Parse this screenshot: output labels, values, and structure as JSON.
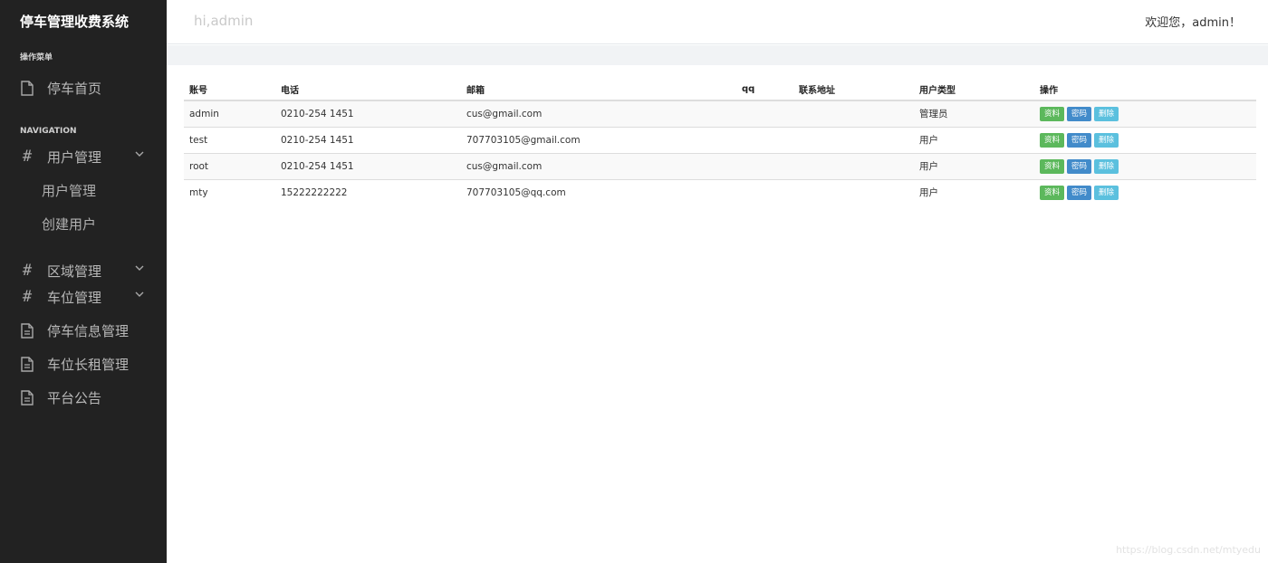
{
  "sidebar": {
    "brand": "停车管理收费系统",
    "section_menu": "操作菜单",
    "home": {
      "label": "停车首页",
      "icon": "file-icon"
    },
    "section_nav": "NAVIGATION",
    "items": [
      {
        "label": "用户管理",
        "icon": "hash-icon",
        "expanded": true,
        "children": [
          {
            "label": "用户管理"
          },
          {
            "label": "创建用户"
          }
        ]
      },
      {
        "label": "区域管理",
        "icon": "hash-icon"
      },
      {
        "label": "车位管理",
        "icon": "hash-icon"
      },
      {
        "label": "停车信息管理",
        "icon": "document-icon"
      },
      {
        "label": "车位长租管理",
        "icon": "document-icon"
      },
      {
        "label": "平台公告",
        "icon": "document-icon"
      }
    ]
  },
  "header": {
    "greeting": "hi,admin",
    "welcome": "欢迎您，admin！"
  },
  "table": {
    "columns": [
      "账号",
      "电话",
      "邮箱",
      "qq",
      "联系地址",
      "用户类型",
      "操作"
    ],
    "rows": [
      {
        "account": "admin",
        "phone": "0210-254 1451",
        "email": "cus@gmail.com",
        "qq": "",
        "address": "",
        "type": "管理员"
      },
      {
        "account": "test",
        "phone": "0210-254 1451",
        "email": "707703105@gmail.com",
        "qq": "",
        "address": "",
        "type": "用户"
      },
      {
        "account": "root",
        "phone": "0210-254 1451",
        "email": "cus@gmail.com",
        "qq": "",
        "address": "",
        "type": "用户"
      },
      {
        "account": "mty",
        "phone": "15222222222",
        "email": "707703105@qq.com",
        "qq": "",
        "address": "",
        "type": "用户"
      }
    ],
    "actions": {
      "profile": "资料",
      "password": "密码",
      "delete": "删除"
    }
  },
  "colors": {
    "sidebar_bg": "#222222",
    "profile_btn": "#5cb85c",
    "password_btn": "#428bca",
    "delete_btn": "#5bc0de"
  },
  "watermark": "https://blog.csdn.net/mtyedu"
}
